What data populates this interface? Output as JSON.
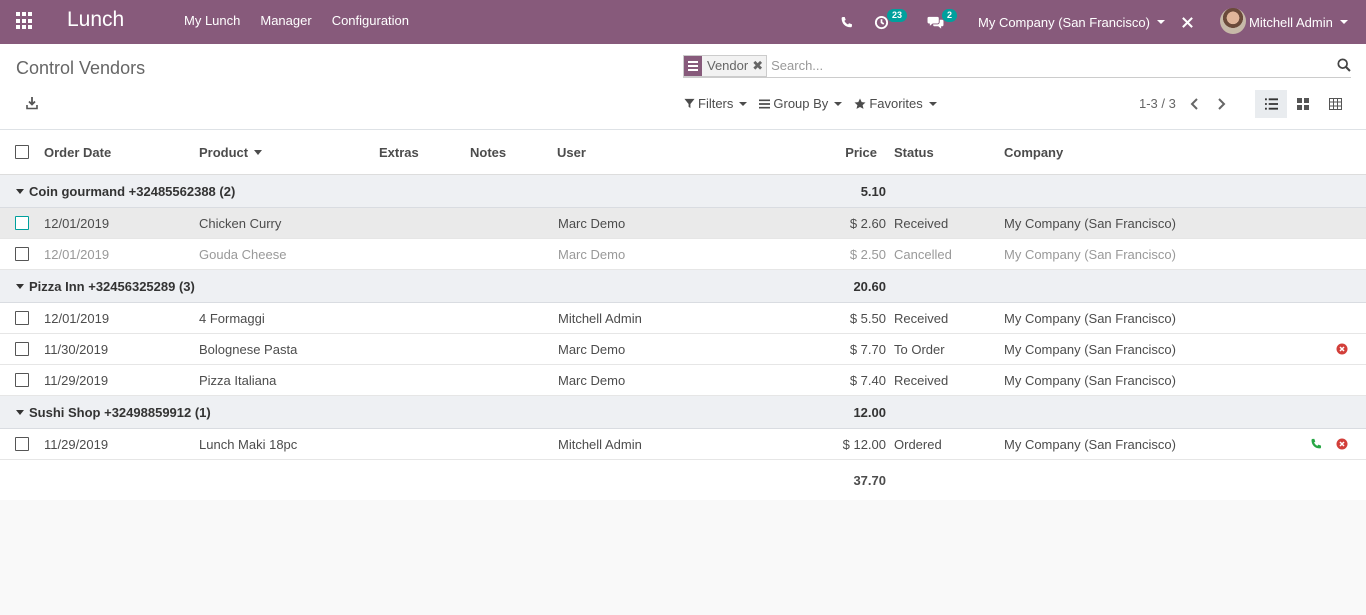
{
  "navbar": {
    "brand": "Lunch",
    "menu": [
      "My Lunch",
      "Manager",
      "Configuration"
    ],
    "activities_count": "23",
    "messages_count": "2",
    "company": "My Company (San Francisco)",
    "user": "Mitchell Admin"
  },
  "control_panel": {
    "breadcrumb": "Control Vendors",
    "facet": "Vendor",
    "facet_remove": "✖",
    "search_placeholder": "Search...",
    "filters": "Filters",
    "group_by": "Group By",
    "favorites": "Favorites",
    "pager": "1-3 / 3"
  },
  "list": {
    "columns": {
      "order_date": "Order Date",
      "product": "Product",
      "extras": "Extras",
      "notes": "Notes",
      "user": "User",
      "price": "Price",
      "status": "Status",
      "company": "Company"
    },
    "groups": [
      {
        "name": "Coin gourmand +32485562388 (2)",
        "total": "5.10",
        "rows": [
          {
            "date": "12/01/2019",
            "product": "Chicken Curry",
            "user": "Marc Demo",
            "price": "$ 2.60",
            "status": "Received",
            "company": "My Company (San Francisco)"
          },
          {
            "date": "12/01/2019",
            "product": "Gouda Cheese",
            "user": "Marc Demo",
            "price": "$ 2.50",
            "status": "Cancelled",
            "company": "My Company (San Francisco)"
          }
        ]
      },
      {
        "name": "Pizza Inn +32456325289 (3)",
        "total": "20.60",
        "rows": [
          {
            "date": "12/01/2019",
            "product": "4 Formaggi",
            "user": "Mitchell Admin",
            "price": "$ 5.50",
            "status": "Received",
            "company": "My Company (San Francisco)"
          },
          {
            "date": "11/30/2019",
            "product": "Bolognese Pasta",
            "user": "Marc Demo",
            "price": "$ 7.70",
            "status": "To Order",
            "company": "My Company (San Francisco)"
          },
          {
            "date": "11/29/2019",
            "product": "Pizza Italiana",
            "user": "Marc Demo",
            "price": "$ 7.40",
            "status": "Received",
            "company": "My Company (San Francisco)"
          }
        ]
      },
      {
        "name": "Sushi Shop +32498859912 (1)",
        "total": "12.00",
        "rows": [
          {
            "date": "11/29/2019",
            "product": "Lunch Maki 18pc",
            "user": "Mitchell Admin",
            "price": "$ 12.00",
            "status": "Ordered",
            "company": "My Company (San Francisco)"
          }
        ]
      }
    ],
    "grand_total": "37.70"
  },
  "colors": {
    "navbar": "#875a7b",
    "badge": "#00a09d",
    "cancel_icon": "#d23f3a",
    "phone_icon": "#28a745"
  },
  "icons": [
    "apps-icon",
    "phone-icon",
    "activity-clock-icon",
    "chat-icon",
    "debug-close-icon",
    "search-icon",
    "download-icon",
    "filter-icon",
    "group-by-icon",
    "star-icon",
    "chevron-left-icon",
    "chevron-right-icon",
    "list-view-icon",
    "kanban-view-icon",
    "pivot-view-icon",
    "cancel-order-icon",
    "call-vendor-icon"
  ]
}
